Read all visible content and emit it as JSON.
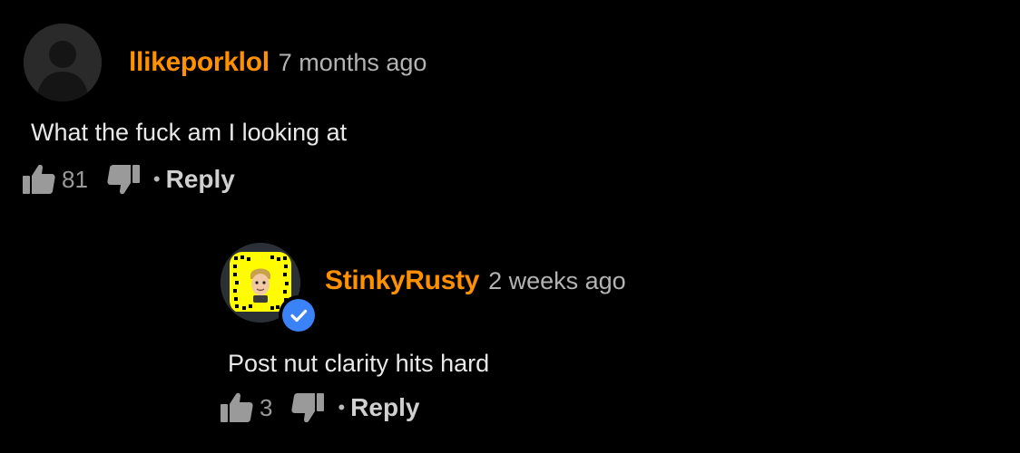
{
  "comments": [
    {
      "username": "llikeporklol",
      "timestamp": "7 months ago",
      "text": "What the fuck am I looking at",
      "likes": "81",
      "reply_label": "Reply",
      "separator": "•"
    },
    {
      "username": "StinkyRusty",
      "timestamp": "2 weeks ago",
      "text": "Post nut clarity hits hard",
      "likes": "3",
      "reply_label": "Reply",
      "separator": "•",
      "verified": true
    }
  ],
  "colors": {
    "background": "#000000",
    "username": "#ff9000",
    "timestamp": "#b3b3b3",
    "verified_badge": "#3b82f6",
    "snapcode_yellow": "#fffc00"
  },
  "icons": {
    "like": "thumbs-up-icon",
    "dislike": "thumbs-down-icon",
    "verified": "check-badge-icon",
    "avatar_default": "default-user-silhouette",
    "avatar_snapcode": "snapcode-avatar"
  }
}
